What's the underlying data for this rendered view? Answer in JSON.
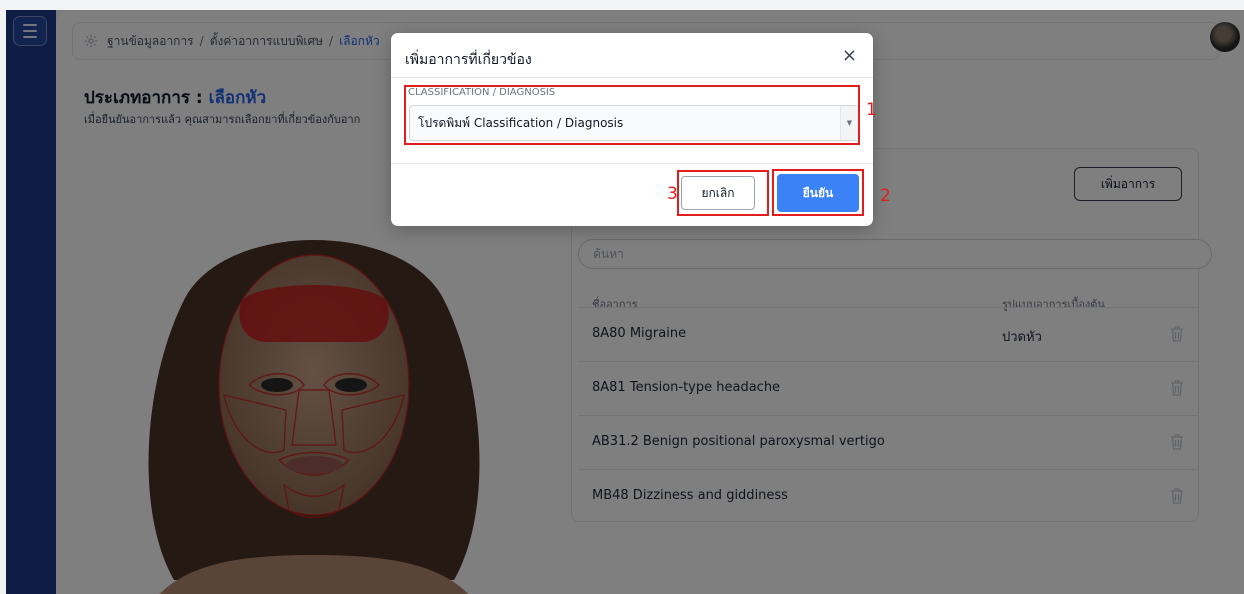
{
  "breadcrumb": [
    "ฐานข้อมูลอาการ",
    "ตั้งค่าอาการแบบพิเศษ",
    "เลือกหัว"
  ],
  "page": {
    "title_prefix": "ประเภทอาการ :",
    "title_value": "เลือกหัว",
    "subtitle": "เมื่อยืนยันอาการแล้ว คุณสามารถเลือกยาที่เกี่ยวข้องกับอาก"
  },
  "panel": {
    "add_button": "เพิ่มอาการ",
    "search_placeholder": "ค้นหา",
    "columns": {
      "name": "ชื่ออาการ",
      "pattern": "รูปแบบอาการเบื้องต้น"
    },
    "rows": [
      {
        "name": "8A80 Migraine",
        "pattern": "ปวดหัว"
      },
      {
        "name": "8A81 Tension-type headache",
        "pattern": ""
      },
      {
        "name": "AB31.2 Benign positional paroxysmal vertigo",
        "pattern": ""
      },
      {
        "name": "MB48 Dizziness and giddiness",
        "pattern": ""
      }
    ]
  },
  "modal": {
    "title": "เพิ่มอาการที่เกี่ยวข้อง",
    "close": "×",
    "field_label": "CLASSIFICATION / DIAGNOSIS",
    "select_placeholder": "โปรดพิมพ์ Classification / Diagnosis",
    "cancel": "ยกเลิก",
    "confirm": "ยืนยัน"
  },
  "annotations": {
    "n1": "1",
    "n2": "2",
    "n3": "3"
  },
  "colors": {
    "sidebar": "#1e3a8a",
    "accent": "#2563eb",
    "confirm": "#3b82f6",
    "annotation": "#e11d1d"
  }
}
